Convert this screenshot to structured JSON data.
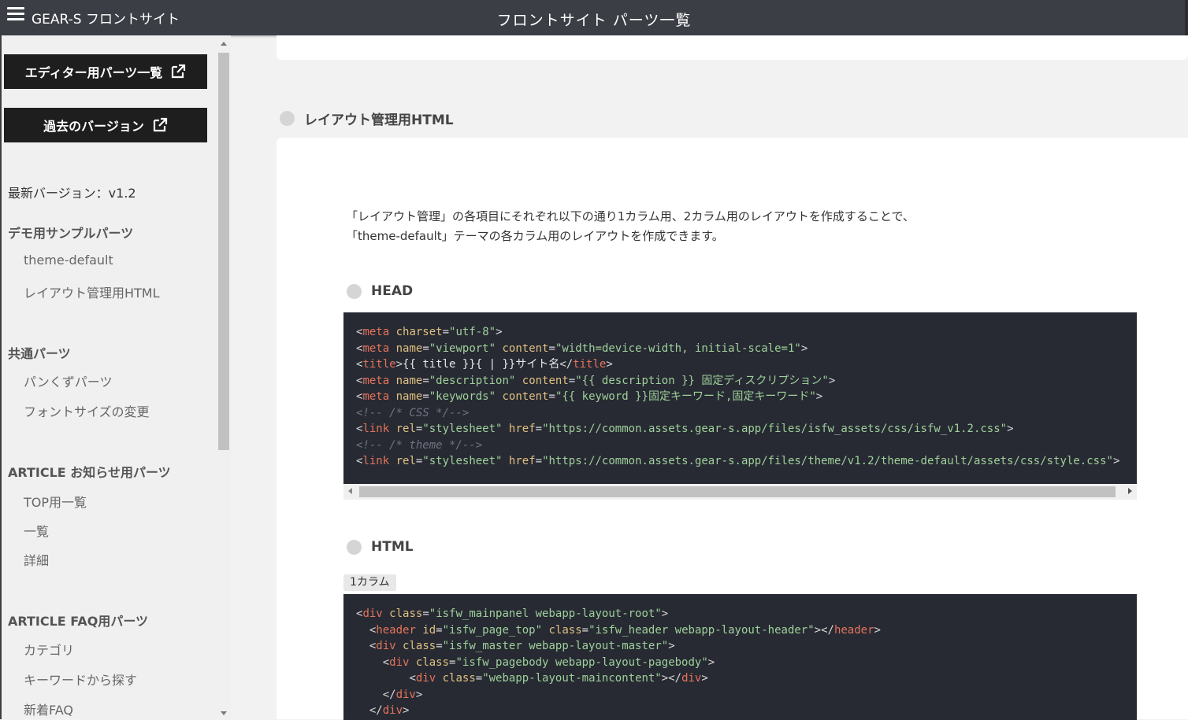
{
  "header": {
    "brand": "GEAR-S フロントサイト",
    "title": "フロントサイト パーツ一覧"
  },
  "sidebar": {
    "buttons": [
      {
        "label": "エディター用パーツ一覧"
      },
      {
        "label": "過去のバージョン"
      }
    ],
    "version": "最新バージョン：v1.2",
    "groups": [
      {
        "heading": "デモ用サンプルパーツ",
        "items": [
          "theme-default",
          "レイアウト管理用HTML"
        ]
      },
      {
        "heading": "共通パーツ",
        "items": [
          "パンくずパーツ",
          "フォントサイズの変更"
        ]
      },
      {
        "heading": "ARTICLE お知らせ用パーツ",
        "items": [
          "TOP用一覧",
          "一覧",
          "詳細"
        ]
      },
      {
        "heading": "ARTICLE FAQ用パーツ",
        "items": [
          "カテゴリ",
          "キーワードから探す",
          "新着FAQ"
        ]
      }
    ]
  },
  "main": {
    "section_title": "レイアウト管理用HTML",
    "description": [
      "「レイアウト管理」の各項目にそれぞれ以下の通り1カラム用、2カラム用のレイアウトを作成することで、",
      "「theme-default」テーマの各カラム用のレイアウトを作成できます。"
    ],
    "head_title": "HEAD",
    "html_title": "HTML",
    "column_badge": "1カラム",
    "head_code": [
      {
        "indent": "",
        "parts": [
          [
            "p",
            "<"
          ],
          [
            "tag",
            "meta"
          ],
          [
            "p",
            " "
          ],
          [
            "attr",
            "charset"
          ],
          [
            "p",
            "="
          ],
          [
            "val",
            "\"utf-8\""
          ],
          [
            "p",
            ">"
          ]
        ]
      },
      {
        "indent": "",
        "parts": [
          [
            "p",
            "<"
          ],
          [
            "tag",
            "meta"
          ],
          [
            "p",
            " "
          ],
          [
            "attr",
            "name"
          ],
          [
            "p",
            "="
          ],
          [
            "val",
            "\"viewport\""
          ],
          [
            "p",
            " "
          ],
          [
            "attr",
            "content"
          ],
          [
            "p",
            "="
          ],
          [
            "val",
            "\"width=device-width, initial-scale=1\""
          ],
          [
            "p",
            ">"
          ]
        ]
      },
      {
        "indent": "",
        "parts": [
          [
            "p",
            "<"
          ],
          [
            "tag",
            "title"
          ],
          [
            "p",
            ">"
          ],
          [
            "txt",
            "{{ title }}{ | }}サイト名"
          ],
          [
            "p",
            "</"
          ],
          [
            "tag",
            "title"
          ],
          [
            "p",
            ">"
          ]
        ]
      },
      {
        "indent": "",
        "parts": [
          [
            "p",
            "<"
          ],
          [
            "tag",
            "meta"
          ],
          [
            "p",
            " "
          ],
          [
            "attr",
            "name"
          ],
          [
            "p",
            "="
          ],
          [
            "val",
            "\"description\""
          ],
          [
            "p",
            " "
          ],
          [
            "attr",
            "content"
          ],
          [
            "p",
            "="
          ],
          [
            "val",
            "\"{{ description }} 固定ディスクリプション\""
          ],
          [
            "p",
            ">"
          ]
        ]
      },
      {
        "indent": "",
        "parts": [
          [
            "p",
            "<"
          ],
          [
            "tag",
            "meta"
          ],
          [
            "p",
            " "
          ],
          [
            "attr",
            "name"
          ],
          [
            "p",
            "="
          ],
          [
            "val",
            "\"keywords\""
          ],
          [
            "p",
            " "
          ],
          [
            "attr",
            "content"
          ],
          [
            "p",
            "="
          ],
          [
            "val",
            "\"{{ keyword }}固定キーワード,固定キーワード\""
          ],
          [
            "p",
            ">"
          ]
        ]
      },
      {
        "indent": "",
        "parts": [
          [
            "cmt",
            "<!-- /* CSS */-->"
          ]
        ]
      },
      {
        "indent": "",
        "parts": [
          [
            "p",
            "<"
          ],
          [
            "tag",
            "link"
          ],
          [
            "p",
            " "
          ],
          [
            "attr",
            "rel"
          ],
          [
            "p",
            "="
          ],
          [
            "val",
            "\"stylesheet\""
          ],
          [
            "p",
            " "
          ],
          [
            "attr",
            "href"
          ],
          [
            "p",
            "="
          ],
          [
            "val",
            "\"https://common.assets.gear-s.app/files/isfw_assets/css/isfw_v1.2.css\""
          ],
          [
            "p",
            ">"
          ]
        ]
      },
      {
        "indent": "",
        "parts": [
          [
            "cmt",
            "<!-- /* theme */-->"
          ]
        ]
      },
      {
        "indent": "",
        "parts": [
          [
            "p",
            "<"
          ],
          [
            "tag",
            "link"
          ],
          [
            "p",
            " "
          ],
          [
            "attr",
            "rel"
          ],
          [
            "p",
            "="
          ],
          [
            "val",
            "\"stylesheet\""
          ],
          [
            "p",
            " "
          ],
          [
            "attr",
            "href"
          ],
          [
            "p",
            "="
          ],
          [
            "val",
            "\"https://common.assets.gear-s.app/files/theme/v1.2/theme-default/assets/css/style.css\""
          ],
          [
            "p",
            ">"
          ]
        ]
      }
    ],
    "html_code": [
      {
        "indent": "",
        "parts": [
          [
            "p",
            "<"
          ],
          [
            "tag",
            "div"
          ],
          [
            "p",
            " "
          ],
          [
            "attr",
            "class"
          ],
          [
            "p",
            "="
          ],
          [
            "val",
            "\"isfw_mainpanel webapp-layout-root\""
          ],
          [
            "p",
            ">"
          ]
        ]
      },
      {
        "indent": "  ",
        "parts": [
          [
            "p",
            "<"
          ],
          [
            "tag",
            "header"
          ],
          [
            "p",
            " "
          ],
          [
            "attr",
            "id"
          ],
          [
            "p",
            "="
          ],
          [
            "val",
            "\"isfw_page_top\""
          ],
          [
            "p",
            " "
          ],
          [
            "attr",
            "class"
          ],
          [
            "p",
            "="
          ],
          [
            "val",
            "\"isfw_header webapp-layout-header\""
          ],
          [
            "p",
            "></"
          ],
          [
            "tag",
            "header"
          ],
          [
            "p",
            ">"
          ]
        ]
      },
      {
        "indent": "  ",
        "parts": [
          [
            "p",
            "<"
          ],
          [
            "tag",
            "div"
          ],
          [
            "p",
            " "
          ],
          [
            "attr",
            "class"
          ],
          [
            "p",
            "="
          ],
          [
            "val",
            "\"isfw_master webapp-layout-master\""
          ],
          [
            "p",
            ">"
          ]
        ]
      },
      {
        "indent": "    ",
        "parts": [
          [
            "p",
            "<"
          ],
          [
            "tag",
            "div"
          ],
          [
            "p",
            " "
          ],
          [
            "attr",
            "class"
          ],
          [
            "p",
            "="
          ],
          [
            "val",
            "\"isfw_pagebody webapp-layout-pagebody\""
          ],
          [
            "p",
            ">"
          ]
        ]
      },
      {
        "indent": "        ",
        "parts": [
          [
            "p",
            "<"
          ],
          [
            "tag",
            "div"
          ],
          [
            "p",
            " "
          ],
          [
            "attr",
            "class"
          ],
          [
            "p",
            "="
          ],
          [
            "val",
            "\"webapp-layout-maincontent\""
          ],
          [
            "p",
            "></"
          ],
          [
            "tag",
            "div"
          ],
          [
            "p",
            ">"
          ]
        ]
      },
      {
        "indent": "    ",
        "parts": [
          [
            "p",
            "</"
          ],
          [
            "tag",
            "div"
          ],
          [
            "p",
            ">"
          ]
        ]
      },
      {
        "indent": "  ",
        "parts": [
          [
            "p",
            "</"
          ],
          [
            "tag",
            "div"
          ],
          [
            "p",
            ">"
          ]
        ]
      }
    ]
  }
}
